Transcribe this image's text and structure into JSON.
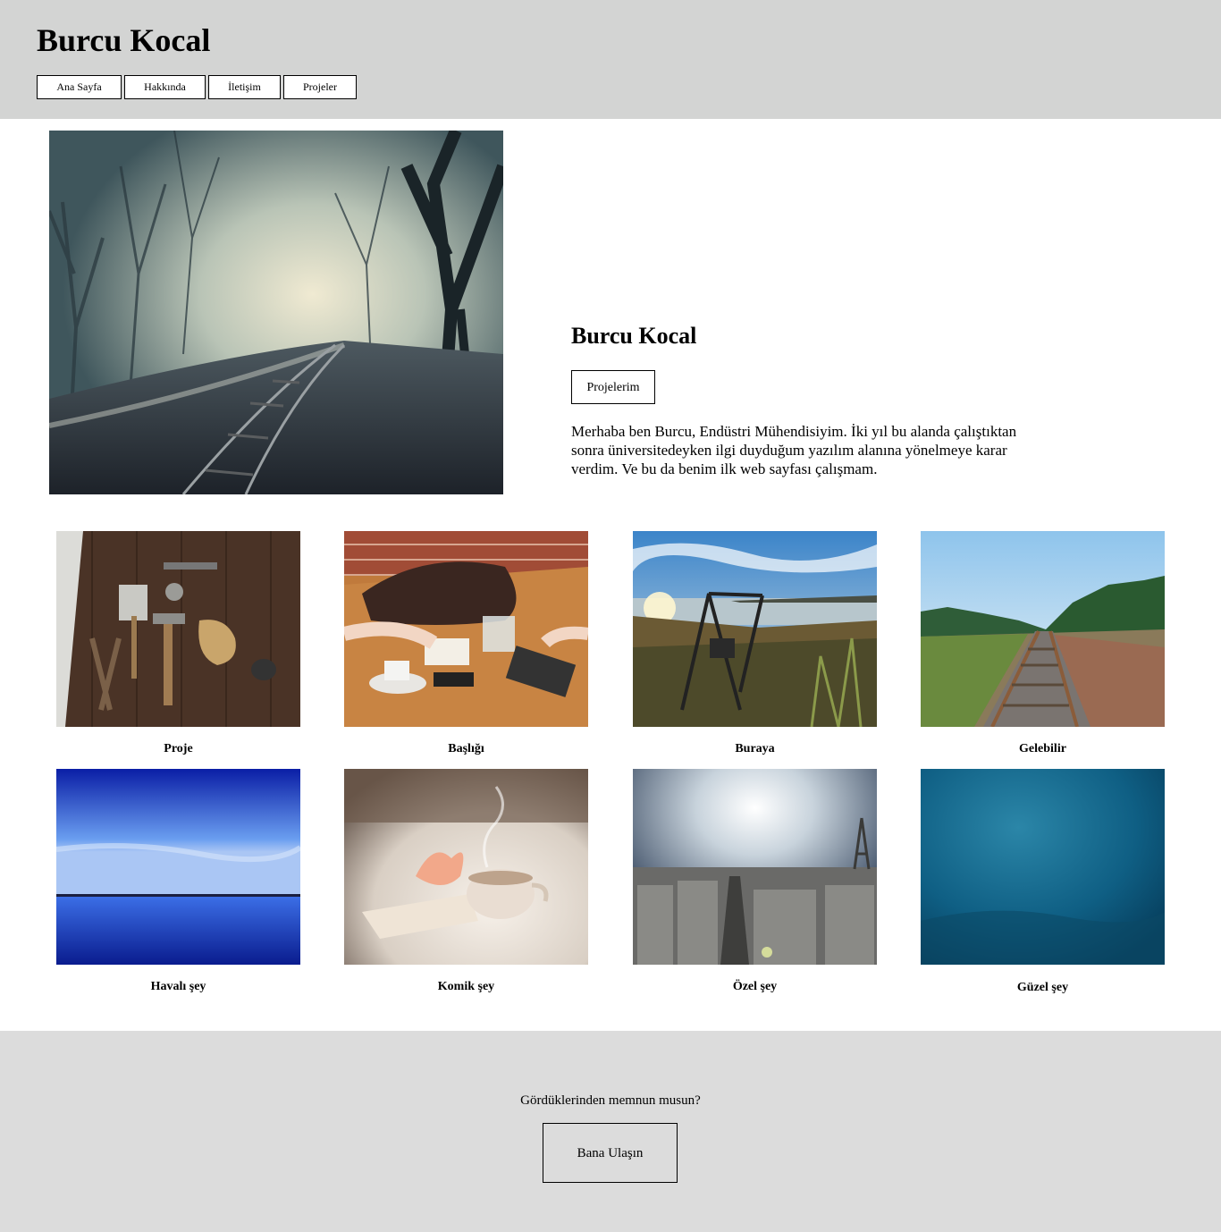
{
  "header": {
    "title": "Burcu Kocal",
    "nav": [
      {
        "label": "Ana Sayfa"
      },
      {
        "label": "Hakkında"
      },
      {
        "label": "İletişim"
      },
      {
        "label": "Projeler"
      }
    ]
  },
  "hero": {
    "image": "misty-forest-railway-photo",
    "name": "Burcu Kocal",
    "button_label": "Projelerim",
    "bio": "Merhaba ben Burcu, Endüstri Mühendisiyim. İki yıl bu alanda çalıştıktan sonra üniversitedeyken ilgi duyduğum yazılım alanına yönelmeye karar verdim. Ve bu da benim ilk web sayfası çalışmam."
  },
  "gallery": [
    {
      "caption": "Proje",
      "image": "tools-on-wood-photo"
    },
    {
      "caption": "Başlığı",
      "image": "cafe-table-photo"
    },
    {
      "caption": "Buraya",
      "image": "lakeside-swing-photo"
    },
    {
      "caption": "Gelebilir",
      "image": "railway-tracks-photo"
    },
    {
      "caption": "Havalı şey",
      "image": "blue-lake-horizon-photo"
    },
    {
      "caption": "Komik şey",
      "image": "coffee-cup-flower-photo"
    },
    {
      "caption": "Özel şey",
      "image": "paris-cityscape-photo"
    },
    {
      "caption": "Güzel şey",
      "image": "underwater-blue-photo"
    }
  ],
  "footer": {
    "question": "Gördüklerinden memnun musun?",
    "button_label": "Bana Ulaşın"
  }
}
